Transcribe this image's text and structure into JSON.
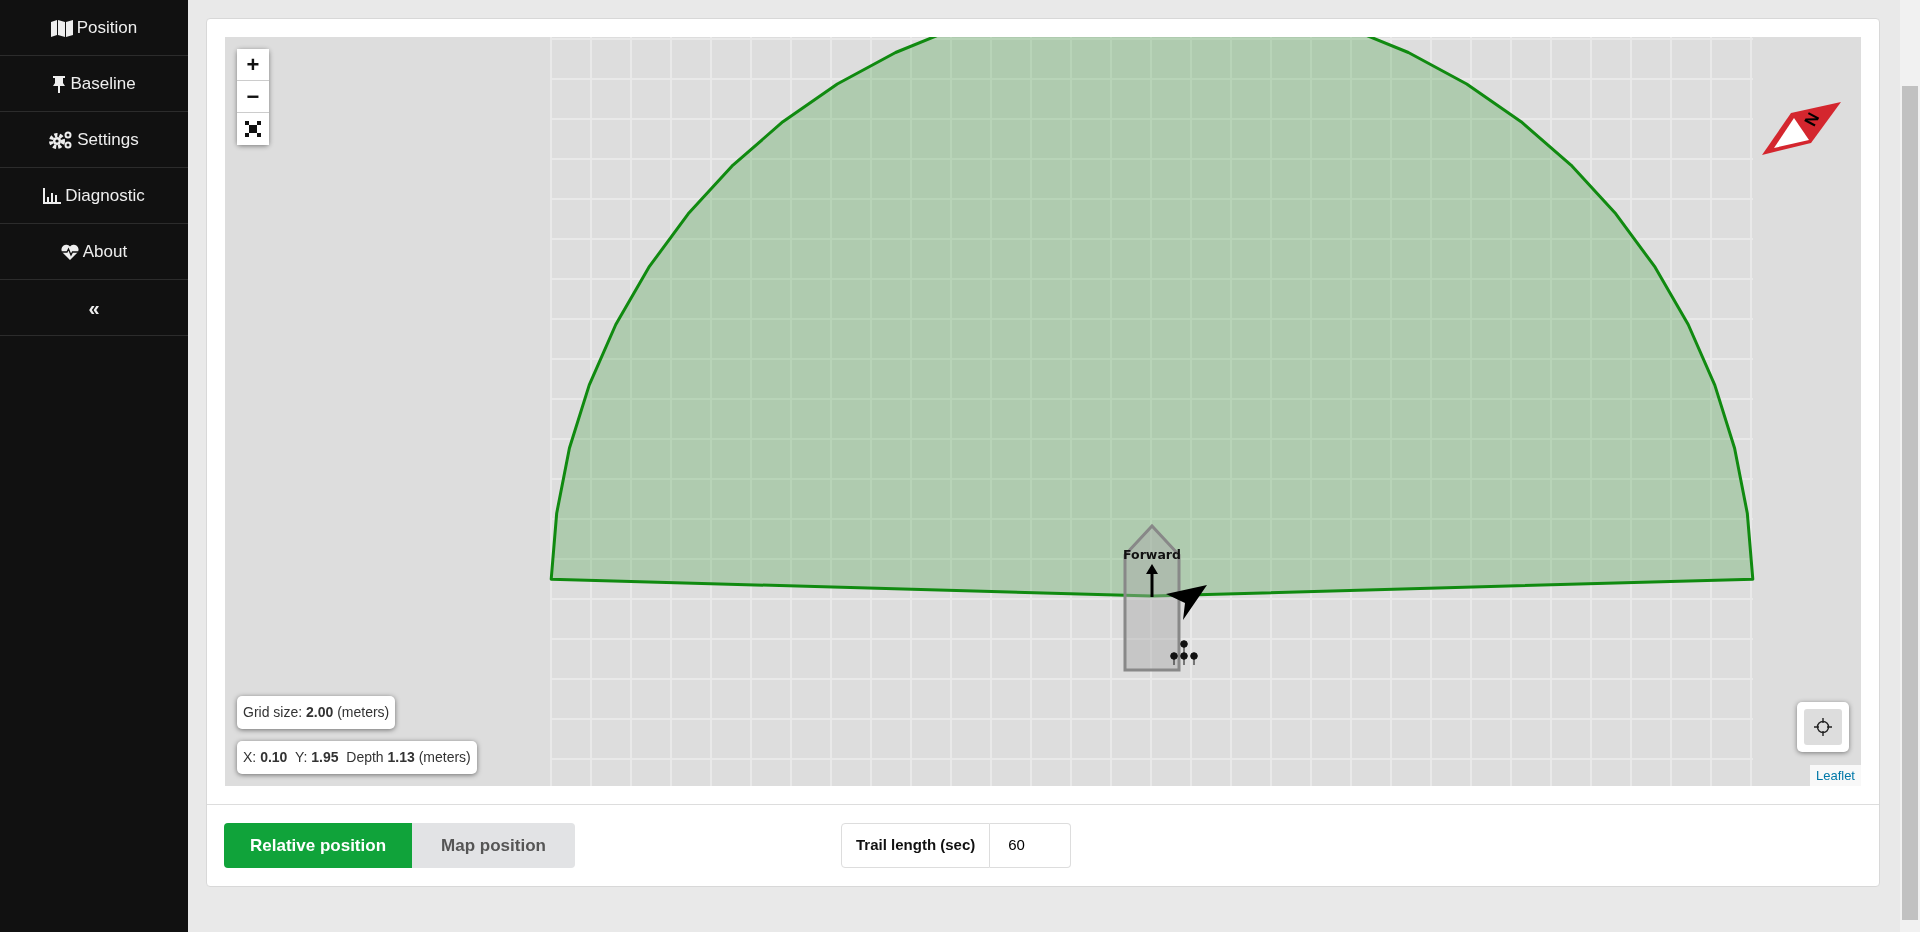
{
  "sidebar": {
    "items": [
      {
        "kind": "map",
        "label": "Position"
      },
      {
        "kind": "pin",
        "label": "Baseline"
      },
      {
        "kind": "gears",
        "label": "Settings"
      },
      {
        "kind": "chart",
        "label": "Diagnostic"
      },
      {
        "kind": "heart",
        "label": "About"
      },
      {
        "kind": "collapse",
        "label": "«"
      }
    ]
  },
  "map": {
    "zoom_in": "+",
    "zoom_out": "−",
    "boat_label": "Forward",
    "compass_label": "N",
    "grid_size": "Grid size: **2.00** (meters)",
    "position": "X: **0.10**  Y: **1.95**  Depth **1.13** (meters)",
    "attribution": "Leaflet"
  },
  "tabs": [
    {
      "label": "Relative position",
      "selected": true
    },
    {
      "label": "Map position",
      "selected": false
    }
  ],
  "trail": {
    "label": "Trail length (sec)",
    "value": "60"
  }
}
